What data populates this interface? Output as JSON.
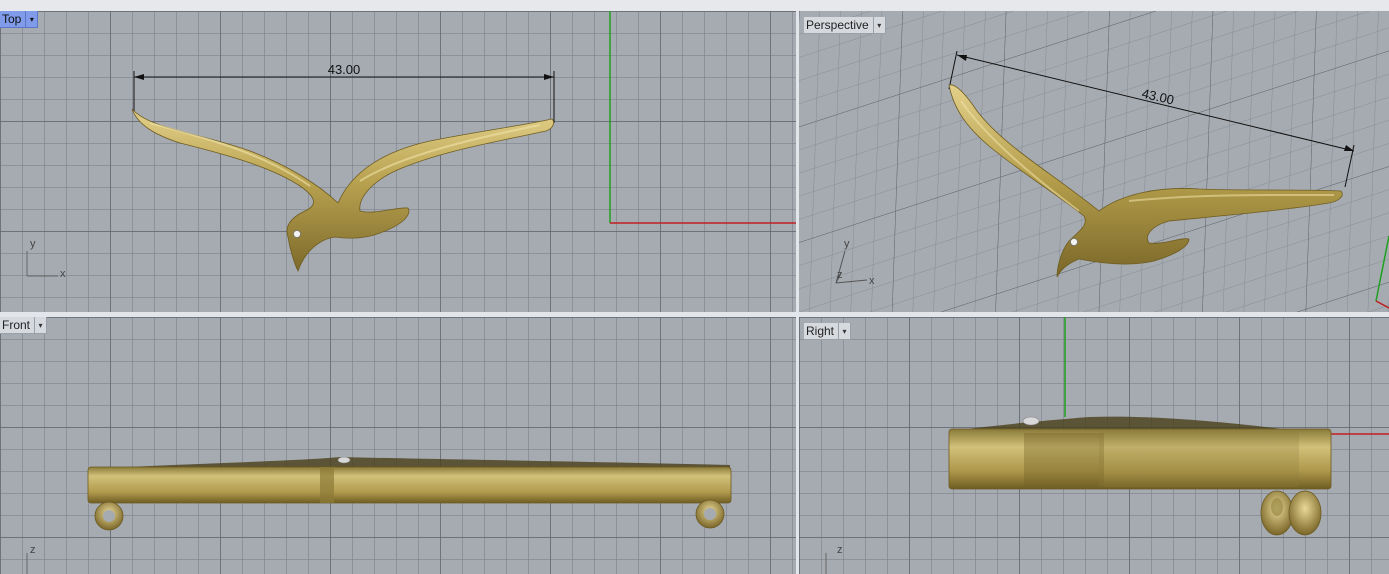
{
  "viewports": {
    "top": {
      "name": "Top",
      "dimension": "43.00",
      "axis_x": "x",
      "axis_y": "y"
    },
    "perspective": {
      "name": "Perspective",
      "dimension": "43.00",
      "axis_x": "x",
      "axis_y": "y",
      "axis_z": "z"
    },
    "front": {
      "name": "Front",
      "axis_z": "z"
    },
    "right": {
      "name": "Right",
      "axis_z": "z"
    }
  },
  "menu_glyph": "▾",
  "colors": {
    "active_tab": "#7f9bea",
    "gold": "#b8a250",
    "x_axis": "#c02020",
    "y_axis": "#20a020",
    "grid_bg": "#a6abb2"
  }
}
